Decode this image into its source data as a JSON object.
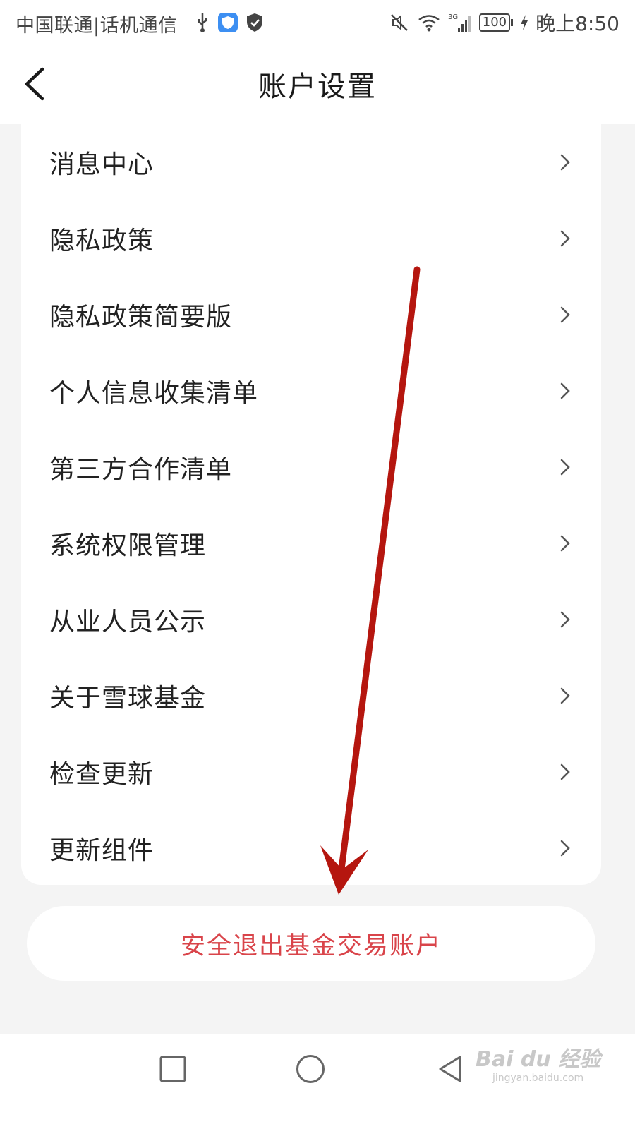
{
  "status_bar": {
    "carrier": "中国联通|话机通信",
    "icons_left": [
      "usb-icon",
      "shield-app-icon",
      "verified-shield-icon"
    ],
    "network": "3G",
    "battery": "100",
    "time": "晚上8:50"
  },
  "nav": {
    "title": "账户设置",
    "back_icon": "chevron-left-icon"
  },
  "settings": {
    "items": [
      {
        "label": "消息中心"
      },
      {
        "label": "隐私政策"
      },
      {
        "label": "隐私政策简要版"
      },
      {
        "label": "个人信息收集清单"
      },
      {
        "label": "第三方合作清单"
      },
      {
        "label": "系统权限管理"
      },
      {
        "label": "从业人员公示"
      },
      {
        "label": "关于雪球基金"
      },
      {
        "label": "检查更新"
      },
      {
        "label": "更新组件"
      }
    ]
  },
  "logout": {
    "label": "安全退出基金交易账户",
    "color": "#d9444a"
  },
  "annotation": {
    "color": "#b5160f"
  },
  "system_nav": [
    "recents-square-icon",
    "home-circle-icon",
    "back-triangle-icon"
  ],
  "watermark": {
    "main": "Bai du 经验",
    "sub": "jingyan.baidu.com"
  }
}
